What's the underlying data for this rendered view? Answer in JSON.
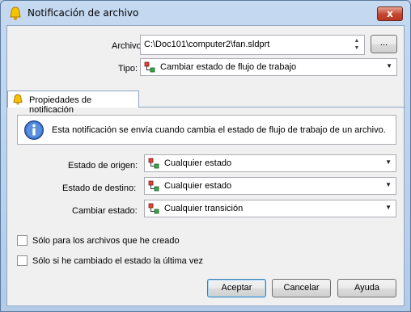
{
  "window": {
    "title": "Notificación de archivo",
    "close_label": "x"
  },
  "archivo": {
    "label": "Archivo:",
    "value": "C:\\Doc101\\computer2\\fan.sldprt",
    "browse_label": "..."
  },
  "tipo": {
    "label": "Tipo:",
    "value": "Cambiar estado de flujo de trabajo"
  },
  "tab": {
    "label": "Propiedades de notificación"
  },
  "info": {
    "text": "Esta notificación se envía cuando cambia el estado de flujo de trabajo de un archivo."
  },
  "estado_origen": {
    "label": "Estado de origen:",
    "value": "Cualquier estado"
  },
  "estado_destino": {
    "label": "Estado de destino:",
    "value": "Cualquier estado"
  },
  "cambiar_estado": {
    "label": "Cambiar estado:",
    "value": "Cualquier transición"
  },
  "checkboxes": [
    {
      "label": "Sólo para los archivos que he creado",
      "checked": false
    },
    {
      "label": "Sólo si he cambiado el estado la última vez",
      "checked": false
    }
  ],
  "buttons": {
    "ok": "Aceptar",
    "cancel": "Cancelar",
    "help": "Ayuda"
  },
  "icons": {
    "title": "bell-icon",
    "tab": "bell-icon",
    "info": "info-icon",
    "workflow": "workflow-state-icon"
  }
}
